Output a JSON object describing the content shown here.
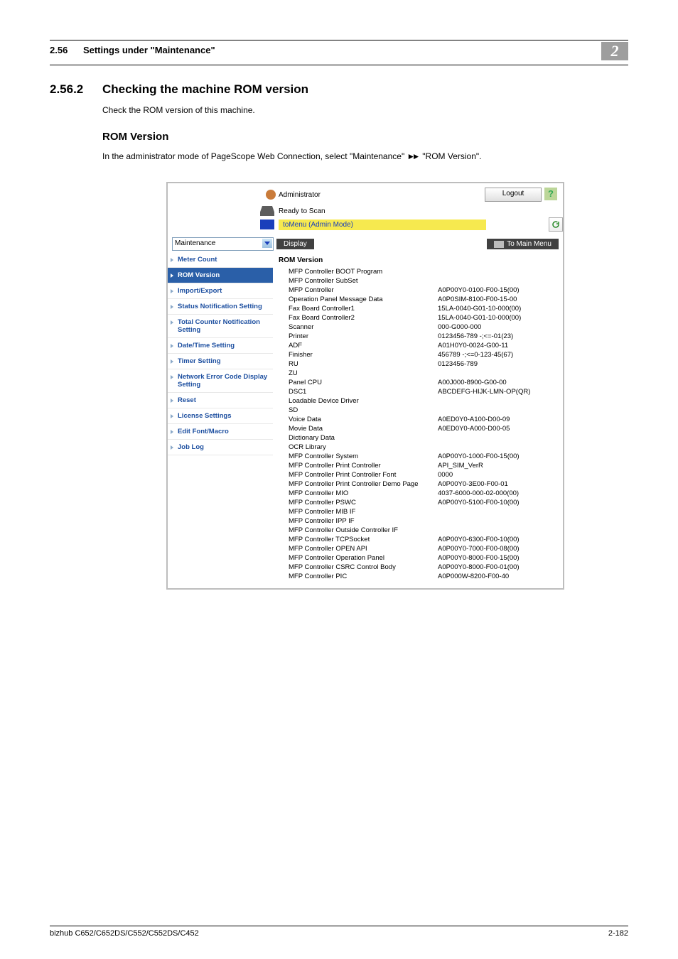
{
  "header": {
    "section_number": "2.56",
    "section_title": "Settings under \"Maintenance\"",
    "chapter_badge": "2"
  },
  "section": {
    "number": "2.56.2",
    "title": "Checking the machine ROM version",
    "intro": "Check the ROM version of this machine."
  },
  "sub": {
    "title": "ROM Version",
    "desc_pre": "In the administrator mode of PageScope Web Connection, select \"Maintenance\" ",
    "desc_post": " \"ROM Version\"."
  },
  "shot": {
    "admin_label": "Administrator",
    "logout": "Logout",
    "help": "?",
    "status_ready": "Ready to Scan",
    "to_menu": "toMenu (Admin Mode)",
    "dropdown": "Maintenance",
    "display_tab": "Display",
    "to_main_menu": "To Main Menu",
    "sidebar": [
      "Meter Count",
      "ROM Version",
      "Import/Export",
      "Status Notification Setting",
      "Total Counter Notification Setting",
      "Date/Time Setting",
      "Timer Setting",
      "Network Error Code Display Setting",
      "Reset",
      "License Settings",
      "Edit Font/Macro",
      "Job Log"
    ],
    "content_title": "ROM Version",
    "rows": [
      {
        "k": "MFP Controller BOOT Program",
        "v": ""
      },
      {
        "k": "MFP Controller SubSet",
        "v": ""
      },
      {
        "k": "MFP Controller",
        "v": "A0P00Y0-0100-F00-15(00)"
      },
      {
        "k": "Operation Panel Message Data",
        "v": "A0P0SIM-8100-F00-15-00"
      },
      {
        "k": "Fax Board Controller1",
        "v": "15LA-0040-G01-10-000(00)"
      },
      {
        "k": "Fax Board Controller2",
        "v": "15LA-0040-G01-10-000(00)"
      },
      {
        "k": "Scanner",
        "v": "000-G000-000"
      },
      {
        "k": "Printer",
        "v": "0123456-789 -;<=-01(23)"
      },
      {
        "k": "ADF",
        "v": "A01H0Y0-0024-G00-11"
      },
      {
        "k": "Finisher",
        "v": "456789 -;<=0-123-45(67)"
      },
      {
        "k": "RU",
        "v": "0123456-789"
      },
      {
        "k": "ZU",
        "v": ""
      },
      {
        "k": "Panel CPU",
        "v": "A00J000-8900-G00-00"
      },
      {
        "k": "DSC1",
        "v": "ABCDEFG-HIJK-LMN-OP(QR)"
      },
      {
        "k": "Loadable Device Driver",
        "v": ""
      },
      {
        "k": "SD",
        "v": ""
      },
      {
        "k": "Voice Data",
        "v": "A0ED0Y0-A100-D00-09"
      },
      {
        "k": "Movie Data",
        "v": "A0ED0Y0-A000-D00-05"
      },
      {
        "k": "Dictionary Data",
        "v": ""
      },
      {
        "k": "OCR Library",
        "v": ""
      },
      {
        "k": "MFP Controller System",
        "v": "A0P00Y0-1000-F00-15(00)"
      },
      {
        "k": "MFP Controller Print Controller",
        "v": "API_SIM_VerR"
      },
      {
        "k": "MFP Controller Print Controller Font",
        "v": "0000"
      },
      {
        "k": "MFP Controller Print Controller Demo Page",
        "v": "A0P00Y0-3E00-F00-01"
      },
      {
        "k": "MFP Controller MIO",
        "v": "4037-6000-000-02-000(00)"
      },
      {
        "k": "MFP Controller PSWC",
        "v": "A0P00Y0-5100-F00-10(00)"
      },
      {
        "k": "MFP Controller MIB IF",
        "v": ""
      },
      {
        "k": "MFP Controller IPP IF",
        "v": ""
      },
      {
        "k": "MFP Controller Outside Controller IF",
        "v": ""
      },
      {
        "k": "MFP Controller TCPSocket",
        "v": "A0P00Y0-6300-F00-10(00)"
      },
      {
        "k": "MFP Controller OPEN API",
        "v": "A0P00Y0-7000-F00-08(00)"
      },
      {
        "k": "MFP Controller Operation Panel",
        "v": "A0P00Y0-8000-F00-15(00)"
      },
      {
        "k": "MFP Controller CSRC Control Body",
        "v": "A0P00Y0-8000-F00-01(00)"
      },
      {
        "k": "MFP Controller PIC",
        "v": "A0P000W-8200-F00-40"
      }
    ]
  },
  "footer": {
    "left": "bizhub C652/C652DS/C552/C552DS/C452",
    "right": "2-182"
  }
}
